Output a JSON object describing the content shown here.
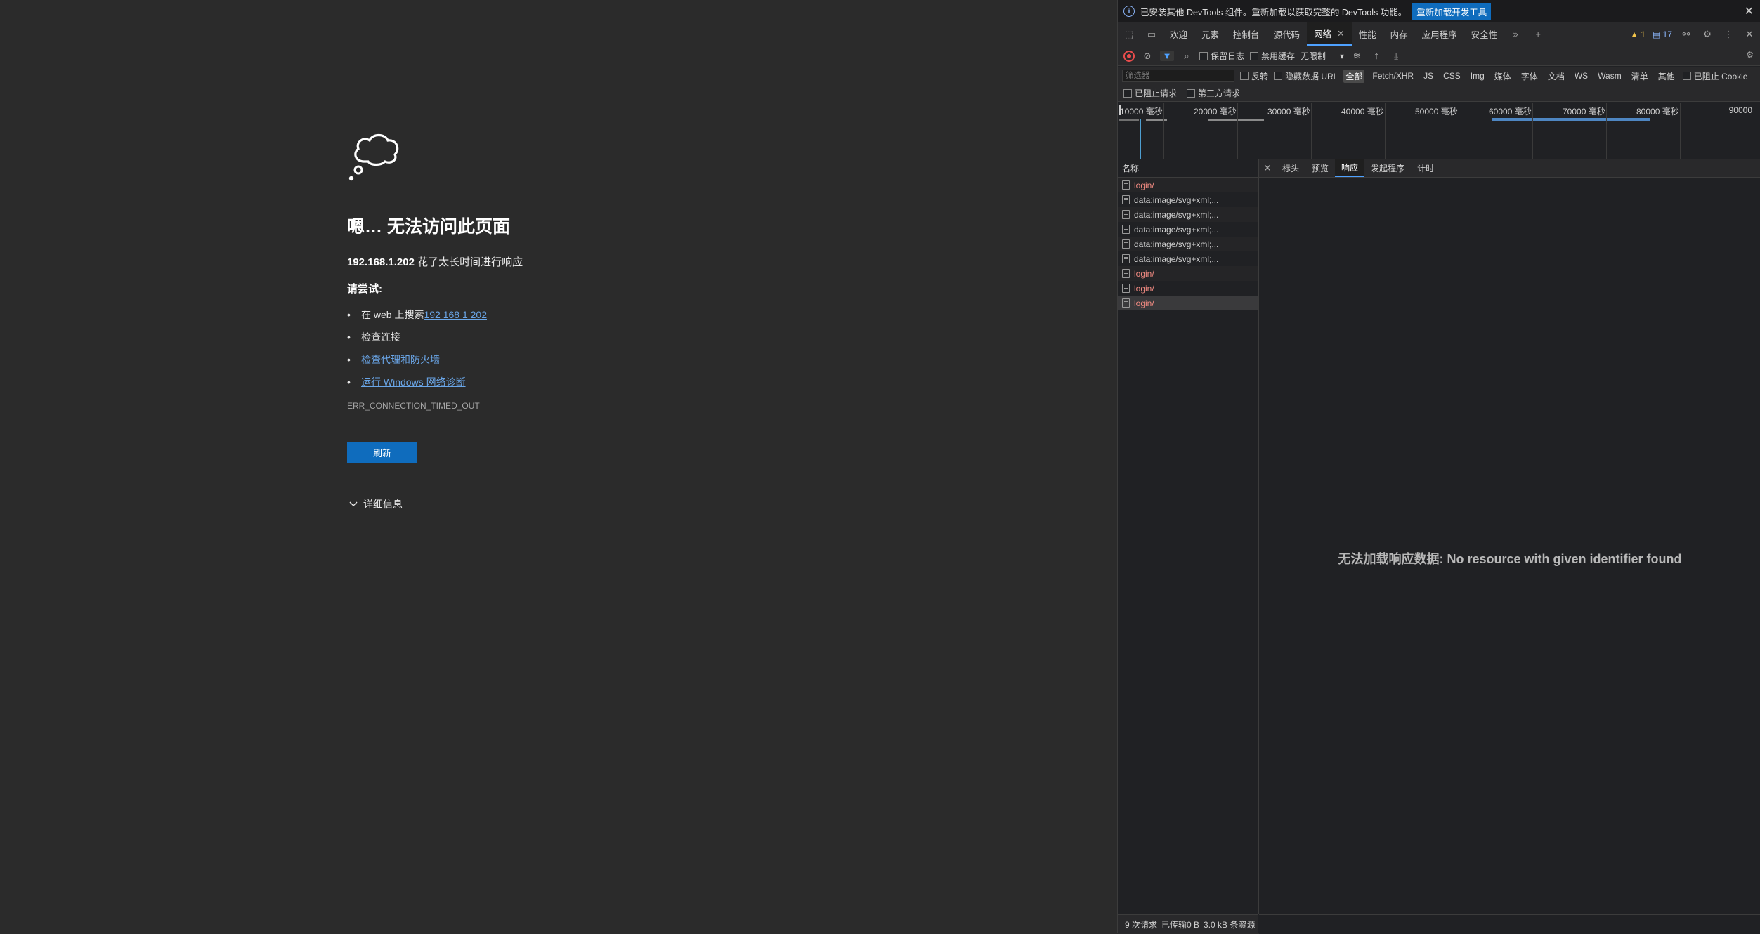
{
  "error_page": {
    "title": "嗯… 无法访问此页面",
    "host": "192.168.1.202",
    "host_suffix": " 花了太长时间进行响应",
    "try_label": "请尝试:",
    "suggestions": [
      {
        "prefix": "在 web 上搜索 ",
        "link": "192 168 1 202"
      },
      {
        "prefix": "检查连接",
        "link": ""
      },
      {
        "prefix": "",
        "link": "检查代理和防火墙"
      },
      {
        "prefix": "",
        "link": "运行 Windows 网络诊断"
      }
    ],
    "error_code": "ERR_CONNECTION_TIMED_OUT",
    "refresh_label": "刷新",
    "details_label": "详细信息"
  },
  "devtools": {
    "infobar": {
      "message": "已安装其他 DevTools 组件。重新加载以获取完整的 DevTools 功能。",
      "reload_label": "重新加载开发工具"
    },
    "tabs": [
      "欢迎",
      "元素",
      "控制台",
      "源代码",
      "网络",
      "性能",
      "内存",
      "应用程序",
      "安全性"
    ],
    "active_tab": "网络",
    "warnings_count": "1",
    "messages_count": "17",
    "toolbar": {
      "preserve_log": "保留日志",
      "disable_cache": "禁用缓存",
      "throttle": "无限制"
    },
    "filter": {
      "placeholder": "筛选器",
      "invert": "反转",
      "hide_data_urls": "隐藏数据 URL",
      "types": [
        "全部",
        "Fetch/XHR",
        "JS",
        "CSS",
        "Img",
        "媒体",
        "字体",
        "文档",
        "WS",
        "Wasm",
        "清单",
        "其他"
      ],
      "active_type": "全部",
      "blocked_cookies": "已阻止 Cookie",
      "blocked_requests": "已阻止请求",
      "third_party": "第三方请求"
    },
    "overview_ticks": [
      "10000  毫秒",
      "20000  毫秒",
      "30000  毫秒",
      "40000  毫秒",
      "50000  毫秒",
      "60000  毫秒",
      "70000  毫秒",
      "80000  毫秒",
      "90000"
    ],
    "name_header": "名称",
    "requests": [
      {
        "name": "login/",
        "status": "error"
      },
      {
        "name": "data:image/svg+xml;...",
        "status": "ok"
      },
      {
        "name": "data:image/svg+xml;...",
        "status": "ok"
      },
      {
        "name": "data:image/svg+xml;...",
        "status": "ok"
      },
      {
        "name": "data:image/svg+xml;...",
        "status": "ok"
      },
      {
        "name": "data:image/svg+xml;...",
        "status": "ok"
      },
      {
        "name": "login/",
        "status": "error"
      },
      {
        "name": "login/",
        "status": "error"
      },
      {
        "name": "login/",
        "status": "error"
      }
    ],
    "detail_tabs": [
      "标头",
      "预览",
      "响应",
      "发起程序",
      "计时"
    ],
    "active_detail_tab": "响应",
    "detail_message": "无法加载响应数据: No resource with given identifier found",
    "status": {
      "requests": "9 次请求",
      "transferred": "已传输0 B",
      "resources": "3.0 kB 条资源"
    }
  }
}
